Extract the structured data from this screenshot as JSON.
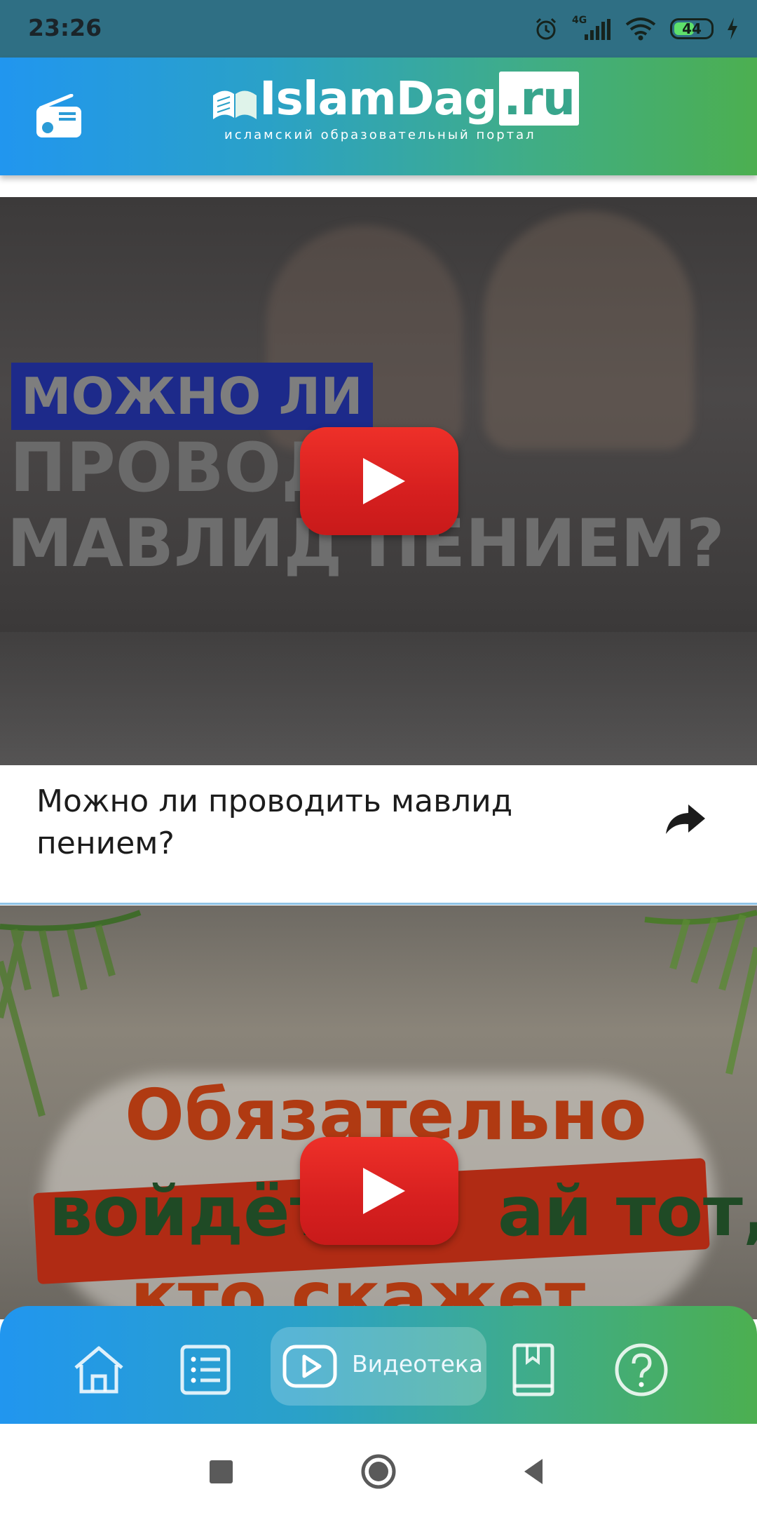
{
  "status_bar": {
    "time": "23:26",
    "network": "4G",
    "battery": "44"
  },
  "header": {
    "logo_text": "IslamDag",
    "logo_tld": ".ru",
    "tagline": "исламский образовательный портал",
    "radio_icon": "radio-icon"
  },
  "videos": [
    {
      "title": "Можно ли проводить мавлид пением?",
      "thumb_lines": [
        "МОЖНО ЛИ",
        "ПРОВОД",
        "МАВЛИД ПЕНИЕМ?"
      ]
    },
    {
      "thumb_lines": [
        "Обязательно",
        "войдёт",
        "ай тот,",
        "кто скажет..."
      ]
    }
  ],
  "bottom_nav": {
    "items": [
      {
        "icon": "home-icon"
      },
      {
        "icon": "list-icon"
      },
      {
        "icon": "video-play-icon",
        "label": "Видеотека",
        "active": true
      },
      {
        "icon": "book-icon"
      },
      {
        "icon": "question-icon"
      }
    ]
  },
  "colors": {
    "header_gradient_start": "#2196ef",
    "header_gradient_end": "#4caf50",
    "play_red": "#e62a25"
  }
}
